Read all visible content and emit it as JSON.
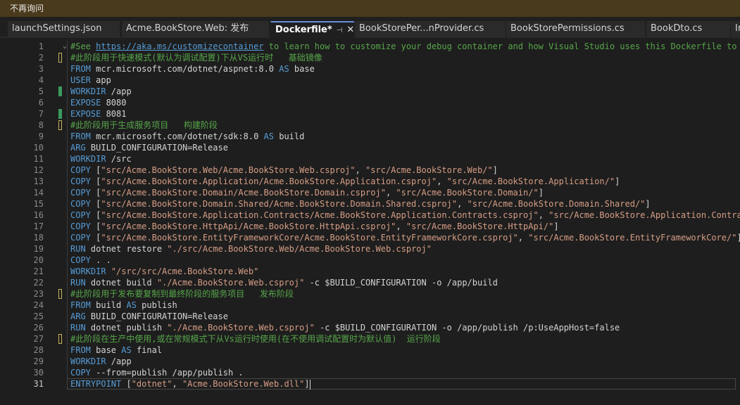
{
  "infobar": {
    "text": "不再询问"
  },
  "tabs": [
    {
      "label": "launchSettings.json",
      "active": false
    },
    {
      "label": "Acme.BookStore.Web: 发布",
      "active": false
    },
    {
      "label": "Dockerfile*",
      "active": true,
      "pin": "⊣",
      "close": "✕"
    },
    {
      "label": "BookStorePer...nProvider.cs",
      "active": false
    },
    {
      "label": "BookStorePermissions.cs",
      "active": false
    },
    {
      "label": "BookDto.cs",
      "active": false
    },
    {
      "label": "Ir",
      "active": false
    }
  ],
  "editor": {
    "current_line": 31,
    "lines": [
      {
        "n": "1",
        "marker": "",
        "parts": [
          {
            "t": "#See ",
            "c": "cm"
          },
          {
            "t": "https://aka.ms/customizecontainer",
            "c": "link"
          },
          {
            "t": " to learn how to customize your debug container and how Visual Studio uses this Dockerfile to buil",
            "c": "cm"
          }
        ]
      },
      {
        "n": "2",
        "marker": "yellow",
        "parts": [
          {
            "t": "#此阶段用于快速模式(默认为调试配置)下从VS运行时   基础镜像",
            "c": "cm"
          }
        ]
      },
      {
        "n": "3",
        "marker": "",
        "parts": [
          {
            "t": "FROM",
            "c": "kw"
          },
          {
            "t": " mcr.microsoft.com/dotnet/aspnet:8.0 ",
            "c": ""
          },
          {
            "t": "AS",
            "c": "kw"
          },
          {
            "t": " base",
            "c": ""
          }
        ]
      },
      {
        "n": "4",
        "marker": "",
        "parts": [
          {
            "t": "USER",
            "c": "kw"
          },
          {
            "t": " app",
            "c": ""
          }
        ]
      },
      {
        "n": "5",
        "marker": "green",
        "parts": [
          {
            "t": "WORKDIR",
            "c": "kw"
          },
          {
            "t": " /app",
            "c": ""
          }
        ]
      },
      {
        "n": "6",
        "marker": "",
        "parts": [
          {
            "t": "EXPOSE",
            "c": "kw"
          },
          {
            "t": " 8080",
            "c": ""
          }
        ]
      },
      {
        "n": "7",
        "marker": "green",
        "parts": [
          {
            "t": "EXPOSE",
            "c": "kw"
          },
          {
            "t": " 8081",
            "c": ""
          }
        ]
      },
      {
        "n": "8",
        "marker": "yellow",
        "parts": [
          {
            "t": "#此阶段用于生成服务项目   构建阶段",
            "c": "cm"
          }
        ]
      },
      {
        "n": "9",
        "marker": "",
        "parts": [
          {
            "t": "FROM",
            "c": "kw"
          },
          {
            "t": " mcr.microsoft.com/dotnet/sdk:8.0 ",
            "c": ""
          },
          {
            "t": "AS",
            "c": "kw"
          },
          {
            "t": " build",
            "c": ""
          }
        ]
      },
      {
        "n": "10",
        "marker": "",
        "parts": [
          {
            "t": "ARG",
            "c": "kw"
          },
          {
            "t": " BUILD_CONFIGURATION=Release",
            "c": ""
          }
        ]
      },
      {
        "n": "11",
        "marker": "",
        "parts": [
          {
            "t": "WORKDIR",
            "c": "kw"
          },
          {
            "t": " /src",
            "c": ""
          }
        ]
      },
      {
        "n": "12",
        "marker": "",
        "parts": [
          {
            "t": "COPY",
            "c": "kw"
          },
          {
            "t": " [",
            "c": ""
          },
          {
            "t": "\"src/Acme.BookStore.Web/Acme.BookStore.Web.csproj\"",
            "c": "str"
          },
          {
            "t": ", ",
            "c": ""
          },
          {
            "t": "\"src/Acme.BookStore.Web/\"",
            "c": "str"
          },
          {
            "t": "]",
            "c": ""
          }
        ]
      },
      {
        "n": "13",
        "marker": "",
        "parts": [
          {
            "t": "COPY",
            "c": "kw"
          },
          {
            "t": " [",
            "c": ""
          },
          {
            "t": "\"src/Acme.BookStore.Application/Acme.BookStore.Application.csproj\"",
            "c": "str"
          },
          {
            "t": ", ",
            "c": ""
          },
          {
            "t": "\"src/Acme.BookStore.Application/\"",
            "c": "str"
          },
          {
            "t": "]",
            "c": ""
          }
        ]
      },
      {
        "n": "14",
        "marker": "",
        "parts": [
          {
            "t": "COPY",
            "c": "kw"
          },
          {
            "t": " [",
            "c": ""
          },
          {
            "t": "\"src/Acme.BookStore.Domain/Acme.BookStore.Domain.csproj\"",
            "c": "str"
          },
          {
            "t": ", ",
            "c": ""
          },
          {
            "t": "\"src/Acme.BookStore.Domain/\"",
            "c": "str"
          },
          {
            "t": "]",
            "c": ""
          }
        ]
      },
      {
        "n": "15",
        "marker": "",
        "parts": [
          {
            "t": "COPY",
            "c": "kw"
          },
          {
            "t": " [",
            "c": ""
          },
          {
            "t": "\"src/Acme.BookStore.Domain.Shared/Acme.BookStore.Domain.Shared.csproj\"",
            "c": "str"
          },
          {
            "t": ", ",
            "c": ""
          },
          {
            "t": "\"src/Acme.BookStore.Domain.Shared/\"",
            "c": "str"
          },
          {
            "t": "]",
            "c": ""
          }
        ]
      },
      {
        "n": "16",
        "marker": "",
        "parts": [
          {
            "t": "COPY",
            "c": "kw"
          },
          {
            "t": " [",
            "c": ""
          },
          {
            "t": "\"src/Acme.BookStore.Application.Contracts/Acme.BookStore.Application.Contracts.csproj\"",
            "c": "str"
          },
          {
            "t": ", ",
            "c": ""
          },
          {
            "t": "\"src/Acme.BookStore.Application.Contracts/",
            "c": "str"
          }
        ]
      },
      {
        "n": "17",
        "marker": "",
        "parts": [
          {
            "t": "COPY",
            "c": "kw"
          },
          {
            "t": " [",
            "c": ""
          },
          {
            "t": "\"src/Acme.BookStore.HttpApi/Acme.BookStore.HttpApi.csproj\"",
            "c": "str"
          },
          {
            "t": ", ",
            "c": ""
          },
          {
            "t": "\"src/Acme.BookStore.HttpApi/\"",
            "c": "str"
          },
          {
            "t": "]",
            "c": ""
          }
        ]
      },
      {
        "n": "18",
        "marker": "",
        "parts": [
          {
            "t": "COPY",
            "c": "kw"
          },
          {
            "t": " [",
            "c": ""
          },
          {
            "t": "\"src/Acme.BookStore.EntityFrameworkCore/Acme.BookStore.EntityFrameworkCore.csproj\"",
            "c": "str"
          },
          {
            "t": ", ",
            "c": ""
          },
          {
            "t": "\"src/Acme.BookStore.EntityFrameworkCore/\"",
            "c": "str"
          },
          {
            "t": "]",
            "c": ""
          }
        ]
      },
      {
        "n": "19",
        "marker": "",
        "parts": [
          {
            "t": "RUN",
            "c": "kw"
          },
          {
            "t": " dotnet restore ",
            "c": ""
          },
          {
            "t": "\"./src/Acme.BookStore.Web/Acme.BookStore.Web.csproj\"",
            "c": "str"
          }
        ]
      },
      {
        "n": "20",
        "marker": "",
        "parts": [
          {
            "t": "COPY",
            "c": "kw"
          },
          {
            "t": " . .",
            "c": ""
          }
        ]
      },
      {
        "n": "21",
        "marker": "",
        "parts": [
          {
            "t": "WORKDIR",
            "c": "kw"
          },
          {
            "t": " ",
            "c": ""
          },
          {
            "t": "\"/src/src/Acme.BookStore.Web\"",
            "c": "str"
          }
        ]
      },
      {
        "n": "22",
        "marker": "",
        "parts": [
          {
            "t": "RUN",
            "c": "kw"
          },
          {
            "t": " dotnet build ",
            "c": ""
          },
          {
            "t": "\"./Acme.BookStore.Web.csproj\"",
            "c": "str"
          },
          {
            "t": " -c $BUILD_CONFIGURATION -o /app/build",
            "c": ""
          }
        ]
      },
      {
        "n": "23",
        "marker": "yellow",
        "parts": [
          {
            "t": "#此阶段用于发布要复制到最终阶段的服务项目   发布阶段",
            "c": "cm"
          }
        ]
      },
      {
        "n": "24",
        "marker": "",
        "parts": [
          {
            "t": "FROM",
            "c": "kw"
          },
          {
            "t": " build ",
            "c": ""
          },
          {
            "t": "AS",
            "c": "kw"
          },
          {
            "t": " publish",
            "c": ""
          }
        ]
      },
      {
        "n": "25",
        "marker": "",
        "parts": [
          {
            "t": "ARG",
            "c": "kw"
          },
          {
            "t": " BUILD_CONFIGURATION=Release",
            "c": ""
          }
        ]
      },
      {
        "n": "26",
        "marker": "",
        "parts": [
          {
            "t": "RUN",
            "c": "kw"
          },
          {
            "t": " dotnet publish ",
            "c": ""
          },
          {
            "t": "\"./Acme.BookStore.Web.csproj\"",
            "c": "str"
          },
          {
            "t": " -c $BUILD_CONFIGURATION -o /app/publish /p:UseAppHost=false",
            "c": ""
          }
        ]
      },
      {
        "n": "27",
        "marker": "yellow",
        "parts": [
          {
            "t": "#此阶段在生产中使用,或在常规模式下从Vs运行时使用(在不使用调试配置时为默认值)  运行阶段",
            "c": "cm"
          }
        ]
      },
      {
        "n": "28",
        "marker": "",
        "parts": [
          {
            "t": "FROM",
            "c": "kw"
          },
          {
            "t": " base ",
            "c": ""
          },
          {
            "t": "AS",
            "c": "kw"
          },
          {
            "t": " final",
            "c": ""
          }
        ]
      },
      {
        "n": "29",
        "marker": "",
        "parts": [
          {
            "t": "WORKDIR",
            "c": "kw"
          },
          {
            "t": " /app",
            "c": ""
          }
        ]
      },
      {
        "n": "30",
        "marker": "",
        "parts": [
          {
            "t": "COPY",
            "c": "kw"
          },
          {
            "t": " --from=publish /app/publish .",
            "c": ""
          }
        ]
      },
      {
        "n": "31",
        "marker": "",
        "parts": [
          {
            "t": "ENTRYPOINT",
            "c": "kw"
          },
          {
            "t": " [",
            "c": ""
          },
          {
            "t": "\"dotnet\"",
            "c": "str"
          },
          {
            "t": ", ",
            "c": ""
          },
          {
            "t": "\"Acme.BookStore.Web.dll\"",
            "c": "str"
          },
          {
            "t": "]",
            "c": ""
          }
        ]
      }
    ]
  },
  "colors": {
    "keyword": "#569cd6",
    "comment": "#57a64a",
    "string": "#d69d85",
    "infobar": "#4a3a1c"
  }
}
